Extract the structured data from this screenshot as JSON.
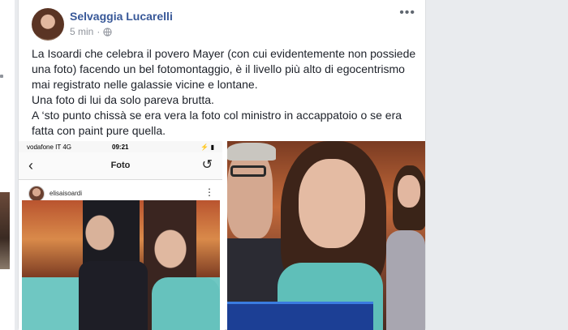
{
  "post": {
    "author": "Selvaggia Lucarelli",
    "time": "5 min",
    "dot": "·",
    "privacy_icon": "globe-icon",
    "more_icon": "more-icon",
    "text": [
      "La Isoardi che celebra il povero Mayer (con cui evidentemente non possiede una foto) facendo un bel fotomontaggio, è il livello più alto di egocentrismo mai registrato nelle galassie vicine e lontane.",
      "Una foto di lui da solo pareva brutta.",
      "A ‘sto punto chissà se era vera la foto col ministro in accappatoio o se era fatta con paint pure quella."
    ]
  },
  "screenshot_phone": {
    "carrier": "vodafone IT  4G",
    "clock": "09:21",
    "status_icons": "⚡ ▮",
    "nav_title": "Foto",
    "back_icon": "‹",
    "refresh_icon": "↺",
    "username": "elisaisoardi",
    "dots": "⋮"
  },
  "colors": {
    "author_link": "#385898",
    "background": "#e9ebee",
    "meta_gray": "#90949c"
  }
}
